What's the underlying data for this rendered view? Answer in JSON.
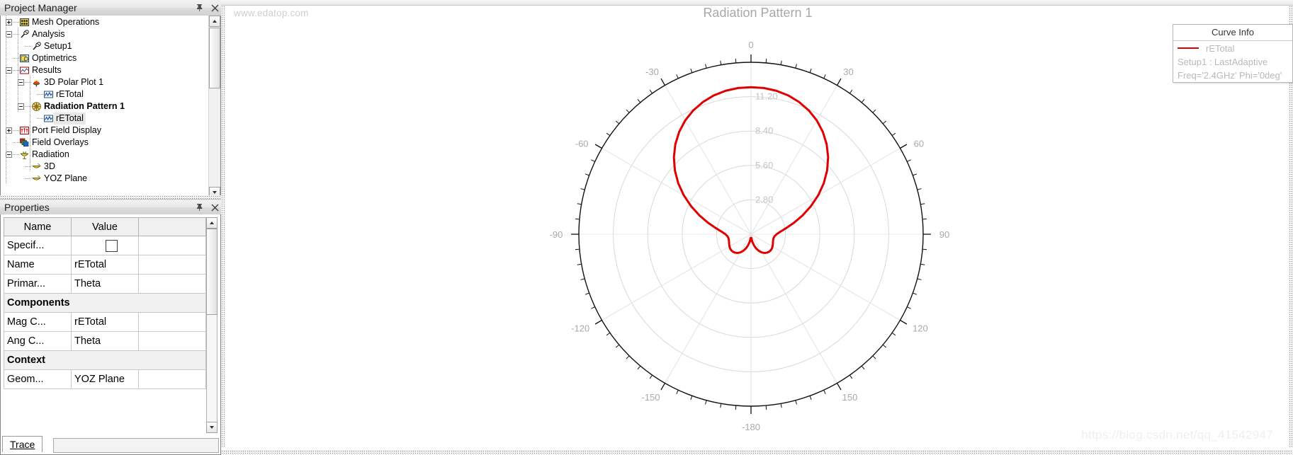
{
  "project_manager": {
    "title": "Project Manager",
    "pin_icon": "pin-icon",
    "close_icon": "close-icon",
    "tree": [
      {
        "label": "Mesh Operations",
        "depth": 1,
        "expander": "plus",
        "icon": "mesh-operations-icon",
        "bold": false,
        "selected": false
      },
      {
        "label": "Analysis",
        "depth": 1,
        "expander": "minus",
        "icon": "analysis-icon",
        "bold": false,
        "selected": false
      },
      {
        "label": "Setup1",
        "depth": 2,
        "expander": "none",
        "icon": "setup-icon",
        "bold": false,
        "selected": false
      },
      {
        "label": "Optimetrics",
        "depth": 1,
        "expander": "none",
        "icon": "optimetrics-icon",
        "bold": false,
        "selected": false
      },
      {
        "label": "Results",
        "depth": 1,
        "expander": "minus",
        "icon": "results-icon",
        "bold": false,
        "selected": false
      },
      {
        "label": "3D Polar Plot 1",
        "depth": 2,
        "expander": "minus",
        "icon": "polar-plot-3d-icon",
        "bold": false,
        "selected": false
      },
      {
        "label": "rETotal",
        "depth": 3,
        "expander": "none",
        "icon": "trace-icon",
        "bold": false,
        "selected": false
      },
      {
        "label": "Radiation Pattern 1",
        "depth": 2,
        "expander": "minus",
        "icon": "radiation-pattern-icon",
        "bold": true,
        "selected": false
      },
      {
        "label": "rETotal",
        "depth": 3,
        "expander": "none",
        "icon": "trace-icon",
        "bold": false,
        "selected": true
      },
      {
        "label": "Port Field Display",
        "depth": 1,
        "expander": "plus",
        "icon": "port-field-icon",
        "bold": false,
        "selected": false
      },
      {
        "label": "Field Overlays",
        "depth": 1,
        "expander": "none",
        "icon": "field-overlays-icon",
        "bold": false,
        "selected": false
      },
      {
        "label": "Radiation",
        "depth": 1,
        "expander": "minus",
        "icon": "radiation-icon",
        "bold": false,
        "selected": false
      },
      {
        "label": "3D",
        "depth": 2,
        "expander": "none",
        "icon": "radiation-sphere-icon",
        "bold": false,
        "selected": false
      },
      {
        "label": "YOZ Plane",
        "depth": 2,
        "expander": "none",
        "icon": "radiation-sphere-icon",
        "bold": false,
        "selected": false
      }
    ]
  },
  "properties": {
    "title": "Properties",
    "pin_icon": "pin-icon",
    "close_icon": "close-icon",
    "columns": [
      "Name",
      "Value",
      ""
    ],
    "rows": [
      {
        "type": "row",
        "name": "Specif...",
        "value": "",
        "control": "checkbox"
      },
      {
        "type": "row",
        "name": "Name",
        "value": "rETotal",
        "control": "text"
      },
      {
        "type": "row",
        "name": "Primar...",
        "value": "Theta",
        "control": "text"
      },
      {
        "type": "section",
        "name": "Components",
        "value": "",
        "control": "none"
      },
      {
        "type": "row",
        "name": "Mag C...",
        "value": "rETotal",
        "control": "text"
      },
      {
        "type": "row",
        "name": "Ang C...",
        "value": "Theta",
        "control": "text"
      },
      {
        "type": "section",
        "name": "Context",
        "value": "",
        "control": "none"
      },
      {
        "type": "row",
        "name": "Geom...",
        "value": "YOZ Plane",
        "control": "text"
      }
    ],
    "tabs": [
      "Trace"
    ],
    "active_tab": "Trace"
  },
  "plot": {
    "watermark_left": "www.edatop.com",
    "watermark_right": "https://blog.csdn.net/qq_41542947",
    "legend": {
      "header": "Curve Info",
      "trace_name": "rETotal",
      "line_color": "#e00000",
      "sub_lines": [
        "Setup1 : LastAdaptive",
        "Freq='2.4GHz' Phi='0deg'"
      ]
    }
  },
  "chart_data": {
    "type": "line",
    "plot_kind": "polar",
    "title": "Radiation Pattern 1",
    "angle_unit": "deg",
    "angle_tick_labels": [
      "0",
      "30",
      "60",
      "90",
      "120",
      "150",
      "-180",
      "-150",
      "-120",
      "-90",
      "-60",
      "-30"
    ],
    "angle_tick_values": [
      0,
      30,
      60,
      90,
      120,
      150,
      180,
      -150,
      -120,
      -90,
      -60,
      -30
    ],
    "angle_major_step": 30,
    "angle_minor_step": 5,
    "radial_tick_labels": [
      "2.80",
      "5.60",
      "8.40",
      "11.20"
    ],
    "radial_tick_values": [
      2.8,
      5.6,
      8.4,
      11.2
    ],
    "rlim": [
      0,
      14.0
    ],
    "grid": true,
    "legend_position": "top-right",
    "series": [
      {
        "name": "rETotal",
        "color": "#e00000",
        "theta_deg": [
          -180,
          -175,
          -170,
          -165,
          -160,
          -155,
          -150,
          -145,
          -140,
          -135,
          -130,
          -125,
          -120,
          -115,
          -110,
          -105,
          -100,
          -95,
          -90,
          -85,
          -80,
          -75,
          -70,
          -65,
          -60,
          -55,
          -50,
          -45,
          -40,
          -35,
          -30,
          -25,
          -20,
          -15,
          -10,
          -5,
          0,
          5,
          10,
          15,
          20,
          25,
          30,
          35,
          40,
          45,
          50,
          55,
          60,
          65,
          70,
          75,
          80,
          85,
          90,
          95,
          100,
          105,
          110,
          115,
          120,
          125,
          130,
          135,
          140,
          145,
          150,
          155,
          160,
          165,
          170,
          175,
          180
        ],
        "r": [
          0.55,
          0.3,
          0.62,
          0.95,
          1.24,
          1.49,
          1.7,
          1.86,
          1.97,
          2.04,
          2.07,
          2.06,
          2.02,
          1.96,
          1.9,
          1.86,
          1.86,
          1.92,
          2.08,
          2.4,
          2.92,
          3.62,
          4.45,
          5.36,
          6.3,
          7.22,
          8.08,
          8.87,
          9.57,
          10.18,
          10.7,
          11.12,
          11.45,
          11.7,
          11.86,
          11.95,
          11.97,
          11.95,
          11.86,
          11.7,
          11.45,
          11.12,
          10.7,
          10.18,
          9.57,
          8.87,
          8.08,
          7.22,
          6.3,
          5.36,
          4.45,
          3.62,
          2.92,
          2.4,
          2.08,
          1.92,
          1.86,
          1.86,
          1.9,
          1.96,
          2.02,
          2.06,
          2.07,
          2.04,
          1.97,
          1.86,
          1.7,
          1.49,
          1.24,
          0.95,
          0.62,
          0.3,
          0.55
        ]
      }
    ]
  }
}
